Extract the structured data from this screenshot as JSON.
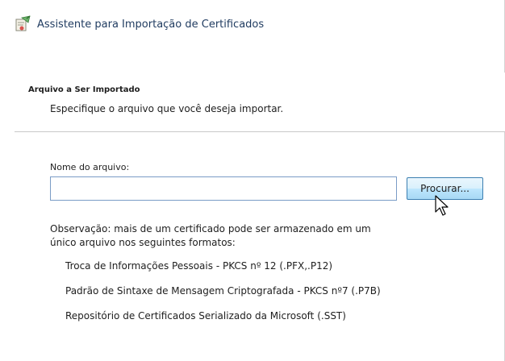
{
  "window": {
    "title": "Assistente para Importação de Certificados",
    "icon": "certificate-wizard-icon"
  },
  "header": {
    "heading": "Arquivo a Ser Importado",
    "description": "Especifique o arquivo que você deseja importar."
  },
  "form": {
    "file_label": "Nome do arquivo:",
    "file_value": "",
    "browse_label": "Procurar..."
  },
  "note": {
    "text": "Observação: mais de um certificado pode ser armazenado em um único arquivo nos seguintes formatos:",
    "formats": [
      "Troca de Informações Pessoais - PKCS nº 12 (.PFX,.P12)",
      "Padrão de Sintaxe de Mensagem Criptografada - PKCS nº7 (.P7B)",
      "Repositório de Certificados Serializado da Microsoft (.SST)"
    ]
  },
  "colors": {
    "input_border": "#7a9cc6",
    "button_border": "#3c7fb1",
    "button_hover": "#bee6fd"
  }
}
